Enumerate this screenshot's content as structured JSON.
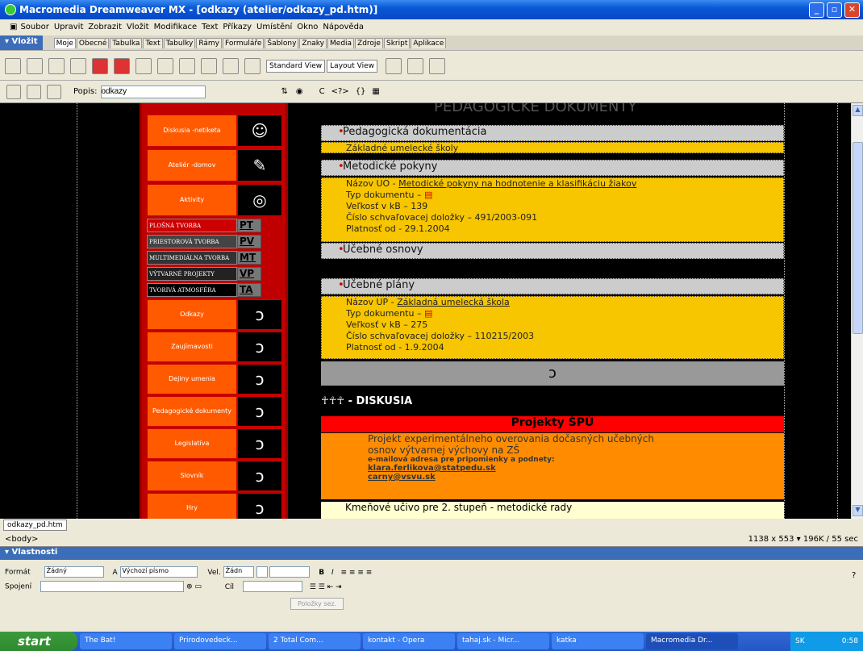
{
  "window": {
    "title": "Macromedia Dreamweaver MX - [odkazy (atelier/odkazy_pd.htm)]"
  },
  "menu": [
    "Soubor",
    "Upravit",
    "Zobrazit",
    "Vložit",
    "Modifikace",
    "Text",
    "Příkazy",
    "Umístění",
    "Okno",
    "Nápověda"
  ],
  "insert": {
    "title": "▾ Vložit",
    "tabs": [
      "Moje",
      "Obecné",
      "Tabulka",
      "Text",
      "Tabulky",
      "Rámy",
      "Formuláře",
      "Šablony",
      "Znaky",
      "Media",
      "Zdroje",
      "Skript",
      "Aplikace"
    ]
  },
  "views": {
    "standard": "Standard View",
    "layout": "Layout View"
  },
  "doc": {
    "label": "Popis:",
    "value": "odkazy"
  },
  "page": {
    "heading": "PEDAGOGICKÉ DOKUMENTY",
    "left_nav": [
      "Diskusia -netiketa",
      "Ateliér -domov",
      "Aktivity"
    ],
    "codes": [
      {
        "t": "PLOŠNÁ TVORBA",
        "c": "PT"
      },
      {
        "t": "PRIESTOROVÁ TVORBA",
        "c": "PV"
      },
      {
        "t": "MULTIMEDIÁLNA TVORBA",
        "c": "MT"
      },
      {
        "t": "VÝTVARNÉ PROJEKTY",
        "c": "VP"
      },
      {
        "t": "TVORIVÁ ATMOSFÉRA",
        "c": "TA"
      }
    ],
    "links": [
      "Odkazy",
      "Zaujímavosti",
      "Dejiny umenia",
      "Pedagogické dokumenty",
      "Legislatíva",
      "Slovník",
      "Hry"
    ],
    "sec1": "Pedagogická dokumentácia",
    "sec1_sub": "Základné umelecké školy",
    "sec2": "Metodické pokyny",
    "mp": [
      "Názov UO - ",
      "Metodické pokyny na hodnotenie a klasifikáciu žiakov",
      "Typ dokumentu – ",
      "Veľkosť v kB – 139",
      "Číslo schvaľovacej doložky – 491/2003-091",
      "Platnosť od - 29.1.2004"
    ],
    "sec3": "Učebné osnovy",
    "sec4": "Učebné plány",
    "up": [
      "Názov UP - ",
      "Základná umelecká škola",
      "Typ dokumentu – ",
      "Veľkosť v kB – 275",
      "Číslo schvaľovacej doložky – 110215/2003",
      "Platnosť od - 1.9.2004"
    ],
    "diskusia": "- DISKUSIA",
    "proj": "Projekty ŠPÚ",
    "proj_text1": "Projekt experimentálneho overovania dočasných učebných",
    "proj_text2": "osnov výtvarnej výchovy na ZŠ",
    "mail_label": "e-mailová adresa pre pripomienky a podnety:",
    "mail1": "klara.ferlikova@statpedu.sk",
    "mail2": "carny@vsvu.sk",
    "kmen": "Kmeňové učivo pre 2. stupeň - metodické rady"
  },
  "file_tab": "odkazy_pd.htm",
  "status": {
    "tag": "<body>",
    "size": "1138 x 553 ▾ 196K / 55 sec"
  },
  "props": {
    "title": "▾ Vlastnosti",
    "format_label": "Formát",
    "format": "Žádný",
    "font": "Výchozí písmo",
    "size_label": "Vel.",
    "size": "Žádn",
    "link_label": "Spojení",
    "target_label": "Cíl",
    "list_btn": "Položky sez."
  },
  "taskbar": {
    "start": "start",
    "items": [
      "The Bat!",
      "Prirodovedeck...",
      "2 Total Com...",
      "kontakt - Opera",
      "tahaj.sk - Micr...",
      "katka",
      "Macromedia Dr..."
    ],
    "lang": "SK",
    "time": "0:58"
  }
}
